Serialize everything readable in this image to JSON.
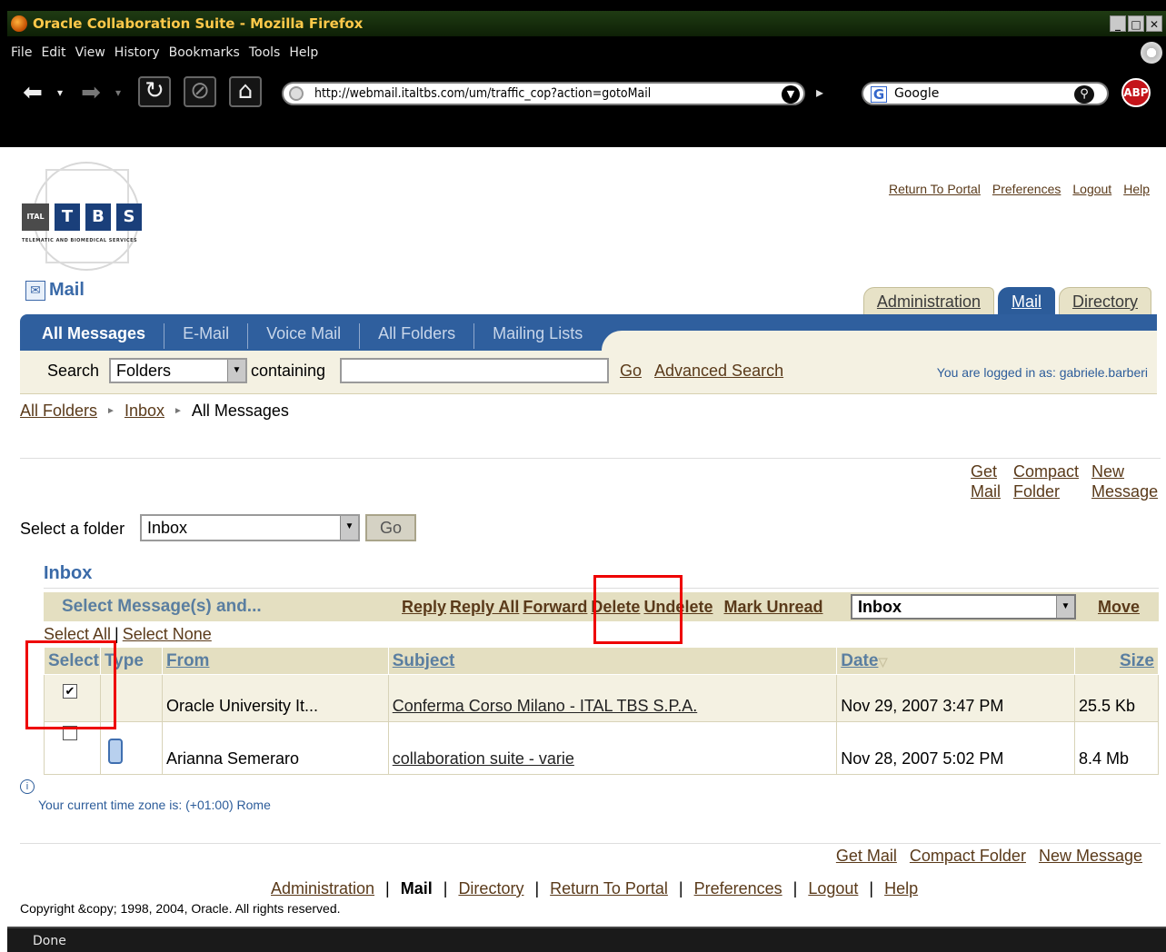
{
  "browser": {
    "window_title": "Oracle Collaboration Suite - Mozilla Firefox",
    "menu": [
      "File",
      "Edit",
      "View",
      "History",
      "Bookmarks",
      "Tools",
      "Help"
    ],
    "url": "http://webmail.italtbs.com/um/traffic_cop?action=gotoMail",
    "search_engine": "Google",
    "adblock_label": "ABP",
    "status": "Done"
  },
  "logo": {
    "blocks": [
      "ITAL",
      "T",
      "B",
      "S"
    ],
    "tagline": "TELEMATIC AND BIOMEDICAL SERVICES"
  },
  "top_links": [
    "Return To Portal",
    "Preferences",
    "Logout",
    "Help"
  ],
  "app": {
    "title": "Mail",
    "tabs": [
      {
        "label": "Administration",
        "active": false
      },
      {
        "label": "Mail",
        "active": true
      },
      {
        "label": "Directory",
        "active": false
      }
    ],
    "subtabs": [
      "All Messages",
      "E-Mail",
      "Voice Mail",
      "All Folders",
      "Mailing Lists"
    ]
  },
  "search": {
    "label": "Search",
    "scope_value": "Folders",
    "containing_label": "containing",
    "query_value": "",
    "go_label": "Go",
    "advanced_label": "Advanced Search",
    "logged_in_text": "You are logged in as:  gabriele.barberi"
  },
  "breadcrumb": [
    "All Folders",
    "Inbox",
    "All Messages"
  ],
  "actions_top": [
    [
      "Get",
      "Mail"
    ],
    [
      "Compact",
      "Folder"
    ],
    [
      "New",
      "Message"
    ]
  ],
  "folder_select": {
    "label": "Select a folder",
    "value": "Inbox",
    "go_label": "Go"
  },
  "inbox": {
    "title": "Inbox",
    "select_title": "Select Message(s) and...",
    "actions": [
      "Reply",
      "Reply All",
      "Forward",
      "Delete",
      "Undelete",
      "Mark Unread"
    ],
    "move_target": "Inbox",
    "move_label": "Move",
    "select_all": "Select All",
    "select_none": "Select None"
  },
  "table": {
    "headers": {
      "select": "Select",
      "type": "Type",
      "from": "From",
      "subject": "Subject",
      "date": "Date",
      "size": "Size"
    },
    "rows": [
      {
        "checked": true,
        "has_attachment": false,
        "from": "Oracle University It...",
        "subject": "Conferma Corso Milano - ITAL TBS S.P.A.",
        "date": "Nov 29, 2007 3:47 PM",
        "size": "25.5 Kb"
      },
      {
        "checked": false,
        "has_attachment": true,
        "from": "Arianna Semeraro",
        "subject": "collaboration suite - varie",
        "date": "Nov 28, 2007 5:02 PM",
        "size": "8.4 Mb"
      }
    ]
  },
  "timezone_text": "Your current time zone is:  (+01:00) Rome",
  "actions_bottom": [
    "Get Mail",
    "Compact Folder",
    "New Message"
  ],
  "footer_links": [
    "Administration",
    "Mail",
    "Directory",
    "Return To Portal",
    "Preferences",
    "Logout",
    "Help"
  ],
  "copyright": "Copyright &copy; 1998, 2004, Oracle. All rights reserved.",
  "colors": {
    "accent_blue": "#2f5f9e",
    "tan_bar": "#e4dfc1",
    "highlight_red": "#ee0000"
  }
}
